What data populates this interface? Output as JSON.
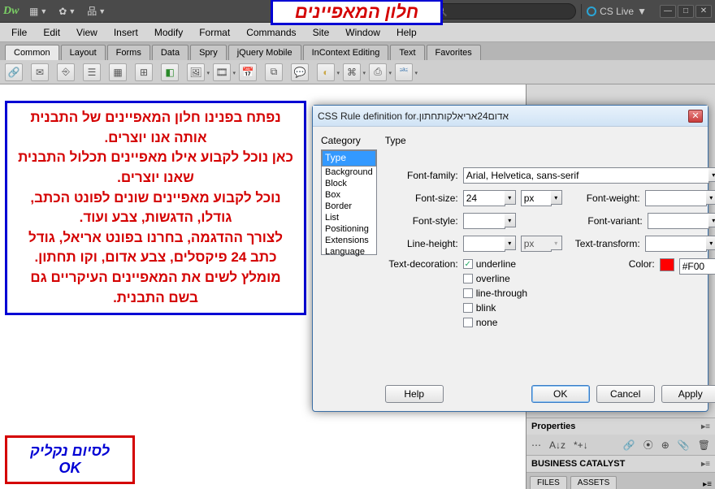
{
  "annotations": {
    "top_title": "חלון המאפיינים",
    "block": "נפתח בפנינו חלון המאפיינים של התבנית אותה אנו יוצרים.\nכאן נוכל לקבוע אילו מאפיינים תכלול התבנית שאנו יוצרים.\nנוכל לקבוע מאפיינים שונים לפונט הכתב, גודלו, הדגשות, צבע ועוד.\nלצורך ההדגמה, בחרנו בפונט אריאל, גודל כתב 24 פיקסלים, צבע אדום, וקו תחתון.\nמומלץ לשים את המאפיינים העיקריים גם בשם התבנית.",
    "ok_box_line1": "לסיום נקליק",
    "ok_box_line2": "OK"
  },
  "topbar": {
    "logo": "Dw",
    "cslive": "CS Live"
  },
  "menubar": [
    "File",
    "Edit",
    "View",
    "Insert",
    "Modify",
    "Format",
    "Commands",
    "Site",
    "Window",
    "Help"
  ],
  "tabs": [
    "Common",
    "Layout",
    "Forms",
    "Data",
    "Spry",
    "jQuery Mobile",
    "InContext Editing",
    "Text",
    "Favorites"
  ],
  "active_tab": "Common",
  "dialog": {
    "title_prefix": "CSS Rule definition for ",
    "rule_name": ".אדום24אריאלקותחתון",
    "category_label": "Category",
    "categories": [
      "Type",
      "Background",
      "Block",
      "Box",
      "Border",
      "List",
      "Positioning",
      "Extensions",
      "Language"
    ],
    "selected_category": "Type",
    "form_title": "Type",
    "labels": {
      "font_family": "Font-family:",
      "font_size": "Font-size:",
      "font_weight": "Font-weight:",
      "font_style": "Font-style:",
      "font_variant": "Font-variant:",
      "line_height": "Line-height:",
      "text_transform": "Text-transform:",
      "text_decoration": "Text-decoration:",
      "color": "Color:"
    },
    "values": {
      "font_family": "Arial, Helvetica, sans-serif",
      "font_size": "24",
      "font_size_unit": "px",
      "line_height_unit": "px",
      "color": "#F00"
    },
    "decorations": {
      "underline": true,
      "overline": false,
      "line_through": false,
      "blink": false,
      "none": false
    },
    "decoration_labels": {
      "underline": "underline",
      "overline": "overline",
      "line_through": "line-through",
      "blink": "blink",
      "none": "none"
    },
    "buttons": {
      "help": "Help",
      "ok": "OK",
      "cancel": "Cancel",
      "apply": "Apply"
    }
  },
  "panels": {
    "properties": "Properties",
    "business_catalyst": "BUSINESS CATALYST",
    "files": "FILES",
    "assets": "ASSETS"
  }
}
